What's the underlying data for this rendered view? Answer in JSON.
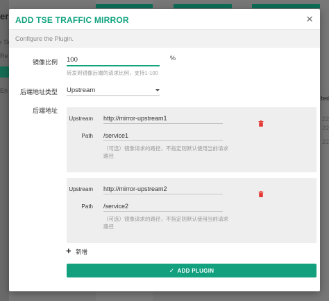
{
  "background": {
    "left_texts": [
      "er",
      "r Se",
      "Re",
      "En"
    ],
    "right_texts": [
      "ted",
      "22",
      "22",
      "22"
    ]
  },
  "modal": {
    "title": "ADD TSE TRAFFIC MIRROR",
    "description": "Configure the Plugin.",
    "close_label": "×",
    "ratio": {
      "label": "镜像比例",
      "value": "100",
      "unit": "%",
      "hint": "转发到镜像后端的请求比例，支持1-100"
    },
    "backend_type": {
      "label": "后端地址类型",
      "selected": "Upstream"
    },
    "backend_address": {
      "label": "后端地址",
      "items": [
        {
          "upstream_label": "Upstream",
          "upstream_value": "http://mirror-upstream1",
          "path_label": "Path",
          "path_value": "/service1",
          "path_hint": "（可选）镜像请求的路径，不指定则默认使用当前请求路径"
        },
        {
          "upstream_label": "Upstream",
          "upstream_value": "http://mirror-upstream2",
          "path_label": "Path",
          "path_value": "/service2",
          "path_hint": "（可选）镜像请求的路径，不指定则默认使用当前请求路径"
        }
      ]
    },
    "add_label": "新增",
    "submit_label": "ADD PLUGIN"
  },
  "colors": {
    "accent": "#11a37f",
    "danger": "#e53935"
  }
}
